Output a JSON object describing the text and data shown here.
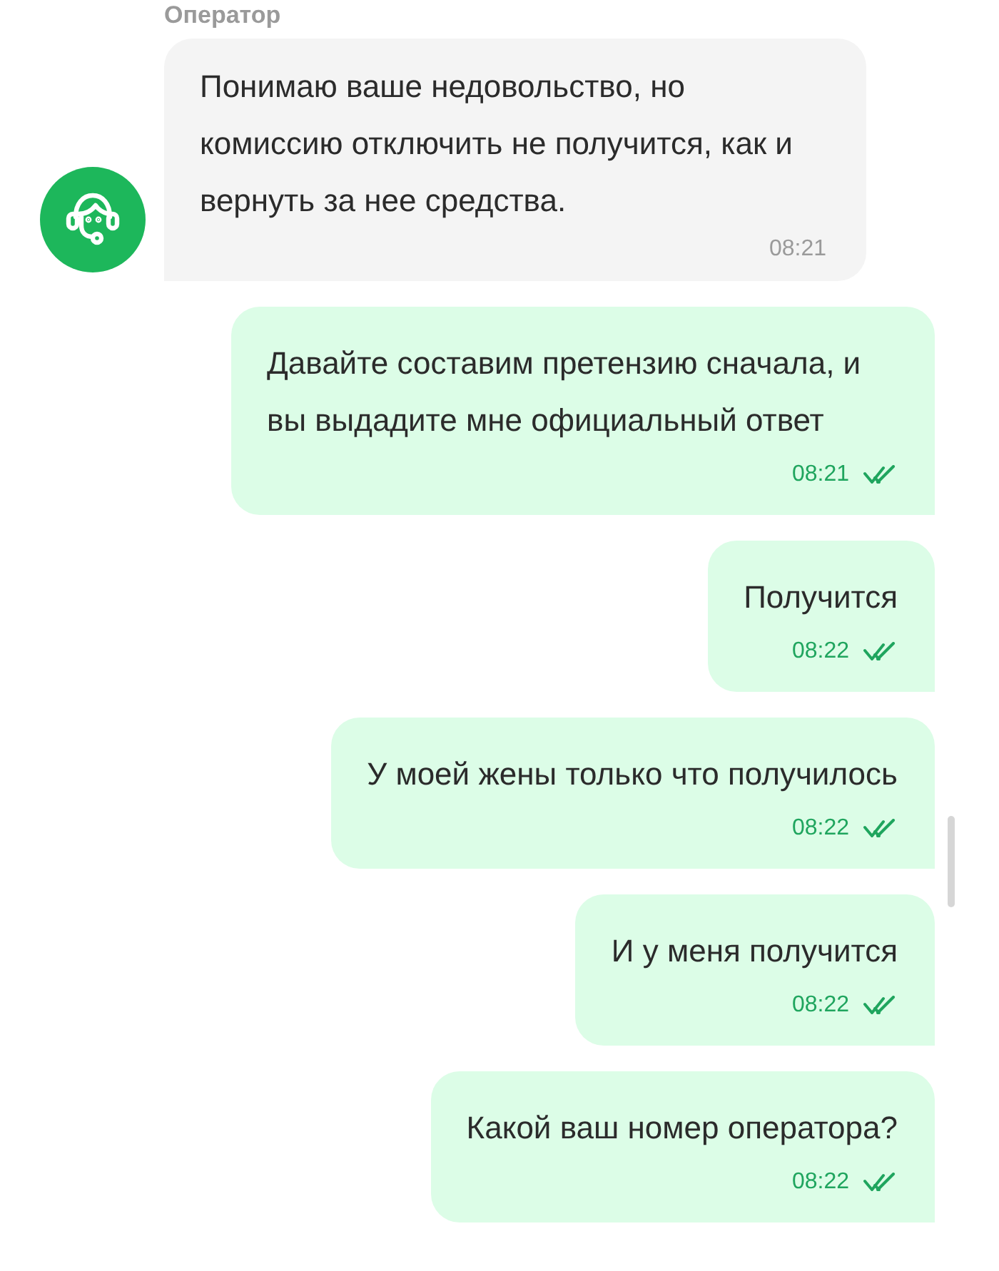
{
  "messages": [
    {
      "kind": "incoming",
      "sender": "Оператор",
      "text": "Понимаю ваше недовольство, но комиссию отключить не получится, как и вернуть за нее средства.",
      "time": "08:21"
    },
    {
      "kind": "outgoing",
      "text": "Давайте составим претензию сначала, и вы выдадите мне официальный ответ",
      "time": "08:21",
      "read": true
    },
    {
      "kind": "outgoing",
      "text": "Получится",
      "time": "08:22",
      "read": true
    },
    {
      "kind": "outgoing",
      "text": "У моей жены только что получилось",
      "time": "08:22",
      "read": true
    },
    {
      "kind": "outgoing",
      "text": "И у меня получится",
      "time": "08:22",
      "read": true
    },
    {
      "kind": "outgoing",
      "text": "Какой ваш номер оператора?",
      "time": "08:22",
      "read": true
    }
  ]
}
